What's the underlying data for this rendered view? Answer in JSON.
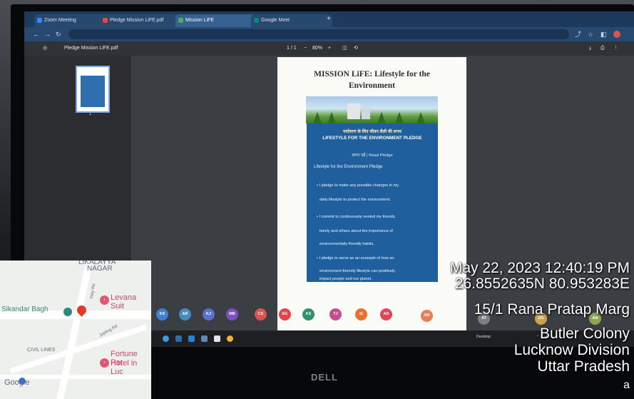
{
  "browser": {
    "tabs": [
      {
        "label": "Zoom Meeting",
        "icon": "zoom-icon",
        "color": "#2d8cff"
      },
      {
        "label": "Pledge Mission LiFE.pdf",
        "icon": "pdf-icon",
        "color": "#e34a3b"
      },
      {
        "label": "Mission LiFE",
        "icon": "leaf-icon",
        "color": "#4caf50"
      },
      {
        "label": "Google Meet",
        "icon": "meet-icon",
        "color": "#00897b"
      }
    ]
  },
  "pdf_viewer": {
    "file_name": "Pledge Mission LiFE.pdf",
    "page_indicator": "1 / 1",
    "zoom": "80%",
    "thumbnail_number": "1"
  },
  "document": {
    "heading_line1": "MISSION LiFE: Lifestyle for the",
    "heading_line2": "Environment",
    "hindi_title": "पर्यावरण के लिए जीवन शैली की शपथ",
    "pledge_title": "LIFESTYLE FOR THE ENVIRONMENT PLEDGE",
    "read_pledge": "शपथ पढ़ें | Read Pledge",
    "section_label": "Lifestyle for the Environment Pledge",
    "pledge_lines": [
      "• I pledge to make any possible changes in my",
      "daily lifestyle to protect the environment.",
      "• I commit to continuously remind my friends,",
      "family and others about the importance of",
      "environmentally friendly habits.",
      "• I pledge to serve as an example of how an",
      "environment-friendly lifestyle can positively",
      "impact people and our planet."
    ]
  },
  "participants": [
    {
      "initials": "KS",
      "color": "#3f7fd0"
    },
    {
      "initials": "AR",
      "color": "#4a8bbd"
    },
    {
      "initials": "KJ",
      "color": "#5a6ed0"
    },
    {
      "initials": "MB",
      "color": "#7a4fc0"
    },
    {
      "initials": "CS",
      "color": "#d9534f"
    },
    {
      "initials": "EG",
      "color": "#e0454b"
    },
    {
      "initials": "KS",
      "color": "#2f8f6f"
    },
    {
      "initials": "TJ",
      "color": "#c74d8e"
    },
    {
      "initials": "IE",
      "color": "#e86f2c"
    },
    {
      "initials": "AD",
      "color": "#e0455a"
    },
    {
      "initials": "SM",
      "color": "#e57f55"
    },
    {
      "initials": "AT",
      "color": "#7a8085"
    },
    {
      "initials": "DS",
      "color": "#caa34a"
    },
    {
      "initials": "AN",
      "color": "#8aa74f"
    }
  ],
  "taskbar": {
    "desktop_label": "Desktop"
  },
  "map": {
    "labels": {
      "area1_line1": "LIKALAYYA",
      "area1_line2": "NAGAR",
      "sikandar_bagh": "Sikandar Bagh",
      "levana": "Levana Suit",
      "fortune1": "Fortune Par",
      "fortune2": "Hotel in Luc",
      "civil_lines": "CIVIL LINES",
      "way_rd": "Way Rd",
      "jopling_rd": "Jopling Rd",
      "google": "Google"
    }
  },
  "geotag": {
    "datetime": "May 22, 2023 12:40:19 PM",
    "coords": "26.8552635N 80.953283E",
    "street": "15/1 Rana Pratap Marg",
    "locality": "Butler Colony",
    "division": "Lucknow Division",
    "state": "Uttar Pradesh",
    "extra": "a"
  },
  "brand": {
    "monitor": "DELL"
  }
}
